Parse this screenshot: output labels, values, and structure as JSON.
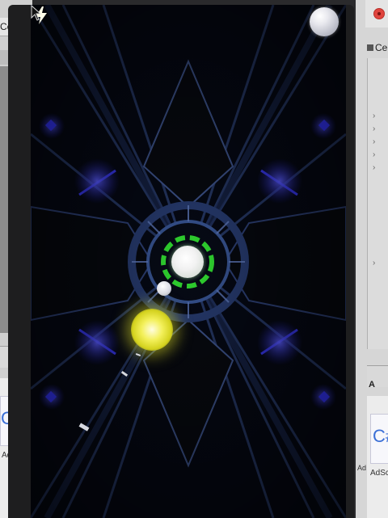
{
  "background_windows": {
    "left": {
      "tab_label": "Cen",
      "file_icon_text": "C#",
      "file_label": "AdSc"
    },
    "right": {
      "tab_label": "Cen",
      "section_label": "A",
      "file_icon_text": "C#",
      "file_label": "AdScr",
      "file_label_2": "Ad"
    }
  },
  "game": {
    "pause_button": "pause-ball",
    "player": "player-core",
    "ring_color": "#2fd22f",
    "orb_color": "#e8e61c",
    "tunnel_glow": "#3f3cff"
  },
  "colors": {
    "accent_blue": "#3b3bff",
    "deep_background": "#03050d",
    "green_ring": "#2fd22f",
    "yellow_orb": "#e8e61c"
  }
}
